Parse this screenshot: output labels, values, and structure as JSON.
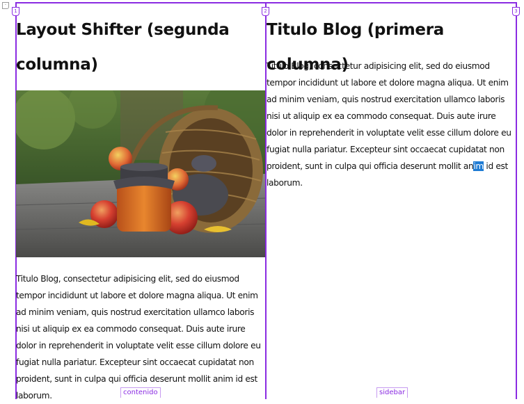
{
  "contenido": {
    "marker": "1",
    "heading": "Layout Shifter (segunda columna)",
    "paragraph": "Titulo Blog, consectetur adipisicing elit, sed do eiusmod tempor incididunt ut labore et dolore magna aliqua. Ut enim ad minim veniam, quis nostrud exercitation ullamco laboris nisi ut aliquip ex ea commodo consequat. Duis aute irure dolor in reprehenderit in voluptate velit esse cillum dolore eu fugiat nulla pariatur. Excepteur sint occaecat cupidatat non proident, sunt in culpa qui officia deserunt mollit anim id est laborum.",
    "label": "contenido"
  },
  "sidebar": {
    "marker": "2",
    "heading": "Titulo Blog (primera columna)",
    "paragraph_before": "Titulo Blog, consectetur adipisicing elit, sed do eiusmod tempor incididunt ut labore et dolore magna aliqua. Ut enim ad minim veniam, quis nostrud exercitation ullamco laboris nisi ut aliquip ex ea commodo consequat. Duis aute irure dolor in reprehenderit in voluptate velit esse cillum dolore eu fugiat nulla pariatur. Excepteur sint occaecat cupidatat non proident, sunt in culpa qui officia deserunt mollit an",
    "paragraph_selected": "im",
    "paragraph_after": " id est laborum.",
    "label": "sidebar"
  },
  "grid_marker_3": "3",
  "colors": {
    "grid": "#8a2be2",
    "selection": "#1e7bd4"
  }
}
